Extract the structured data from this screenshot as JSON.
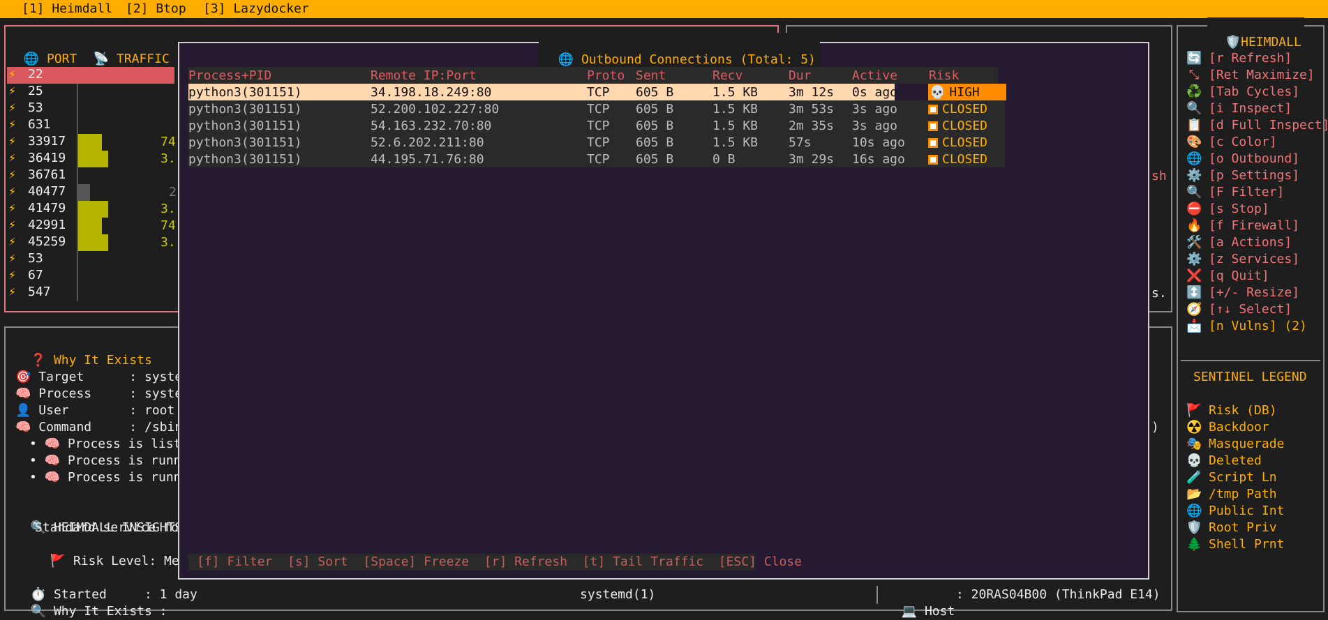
{
  "tabs": [
    "[1] Heimdall",
    "[2] Btop",
    "[3] Lazydocker"
  ],
  "left_panel": {
    "col_port": "PORT",
    "col_traffic": "TRAFFIC",
    "ports": [
      "22",
      "25",
      "53",
      "631",
      "33917",
      "36419",
      "36761",
      "40477",
      "41479",
      "42991",
      "45259",
      "53",
      "67",
      "547"
    ],
    "traffic_values": [
      "",
      "",
      "",
      "",
      "74",
      "3.",
      "",
      "2",
      "3.",
      "74",
      "3.",
      "",
      "",
      ""
    ],
    "traffic_fill": [
      0,
      0,
      0,
      0,
      0.7,
      0.9,
      0,
      0.35,
      0.9,
      0.7,
      0.9,
      0,
      0,
      0
    ]
  },
  "why": {
    "title": "Why It Exists",
    "rows": [
      {
        "icon": "target-icon",
        "glyph": "🎯",
        "text": "Target      : system"
      },
      {
        "icon": "brain-icon",
        "glyph": "🧠",
        "text": "Process     : system"
      },
      {
        "icon": "user-icon",
        "glyph": "👤",
        "text": "User        : root"
      },
      {
        "icon": "brain-icon",
        "glyph": "🧠",
        "text": "Command     : /sbin/"
      }
    ],
    "bullets": [
      "Process is liste",
      "Process is runni",
      "Process is runni"
    ],
    "insights_title": "HEIMDALL INSIGHTS (S",
    "insights_text": "Standard service for",
    "risk_level": "Risk Level: Mediu",
    "started": "Started     : 1 day",
    "why_label": "Why It Exists :",
    "process_name": "systemd(1)"
  },
  "host": {
    "label": "Host",
    "value": ": 20RAS04B00 (ThinkPad E14)"
  },
  "modal": {
    "title": "Outbound Connections (Total: 5)",
    "headers": [
      "Process+PID",
      "Remote IP:Port",
      "Proto",
      "Sent",
      "Recv",
      "Dur",
      "Active",
      "Risk"
    ],
    "rows": [
      {
        "process": "python3(301151)",
        "remote": "34.198.18.249:80",
        "proto": "TCP",
        "sent": "605 B",
        "recv": "1.5 KB",
        "dur": "3m 12s",
        "active": "0s ago",
        "risk": "HIGH"
      },
      {
        "process": "python3(301151)",
        "remote": "52.200.102.227:80",
        "proto": "TCP",
        "sent": "605 B",
        "recv": "1.5 KB",
        "dur": "3m 53s",
        "active": "3s ago",
        "risk": "CLOSED"
      },
      {
        "process": "python3(301151)",
        "remote": "54.163.232.70:80",
        "proto": "TCP",
        "sent": "605 B",
        "recv": "1.5 KB",
        "dur": "2m 35s",
        "active": "3s ago",
        "risk": "CLOSED"
      },
      {
        "process": "python3(301151)",
        "remote": "52.6.202.211:80",
        "proto": "TCP",
        "sent": "605 B",
        "recv": "1.5 KB",
        "dur": "57s",
        "active": "10s ago",
        "risk": "CLOSED"
      },
      {
        "process": "python3(301151)",
        "remote": "44.195.71.76:80",
        "proto": "TCP",
        "sent": "605 B",
        "recv": "0 B",
        "dur": "3m 29s",
        "active": "16s ago",
        "risk": "CLOSED"
      }
    ],
    "footer": "[f] Filter  [s] Sort  [Space] Freeze  [r] Refresh  [t] Tail Traffic  [ESC] Close"
  },
  "right_panel": {
    "title": "HEIMDALL",
    "items": [
      {
        "icon": "refresh-icon",
        "glyph": "🔄",
        "label": "[r Refresh]"
      },
      {
        "icon": "maximize-icon",
        "glyph": "⤡",
        "label": "[Ret Maximize]"
      },
      {
        "icon": "cycle-icon",
        "glyph": "♻️",
        "label": "[Tab Cycles]"
      },
      {
        "icon": "search-icon",
        "glyph": "🔍",
        "label": "[i Inspect]"
      },
      {
        "icon": "clipboard-icon",
        "glyph": "📋",
        "label": "[d Full Inspect]"
      },
      {
        "icon": "palette-icon",
        "glyph": "🎨",
        "label": "[c Color]"
      },
      {
        "icon": "globe-icon",
        "glyph": "🌐",
        "label": "[o Outbound]"
      },
      {
        "icon": "gear-icon",
        "glyph": "⚙️",
        "label": "[p Settings]"
      },
      {
        "icon": "search-icon",
        "glyph": "🔍",
        "label": "[F Filter]"
      },
      {
        "icon": "stop-icon",
        "glyph": "⛔",
        "label": "[s Stop]"
      },
      {
        "icon": "fire-icon",
        "glyph": "🔥",
        "label": "[f Firewall]"
      },
      {
        "icon": "tools-icon",
        "glyph": "🛠️",
        "label": "[a Actions]"
      },
      {
        "icon": "gear-icon",
        "glyph": "⚙️",
        "label": "[z Services]"
      },
      {
        "icon": "close-icon",
        "glyph": "❌",
        "label": "[q Quit]"
      },
      {
        "icon": "resize-icon",
        "glyph": "↕️",
        "label": "[+/- Resize]"
      },
      {
        "icon": "compass-icon",
        "glyph": "🧭",
        "label": "[↑↓ Select]"
      },
      {
        "icon": "inbox-icon",
        "glyph": "📩",
        "label": "[n Vulns] (2)"
      }
    ],
    "legend_title": "SENTINEL LEGEND",
    "legend": [
      {
        "icon": "flag-icon",
        "glyph": "🚩",
        "label": "Risk (DB)"
      },
      {
        "icon": "radioactive-icon",
        "glyph": "☢️",
        "label": "Backdoor"
      },
      {
        "icon": "masks-icon",
        "glyph": "🎭",
        "label": "Masquerade"
      },
      {
        "icon": "skull-icon",
        "glyph": "💀",
        "label": "Deleted"
      },
      {
        "icon": "testtube-icon",
        "glyph": "🧪",
        "label": "Script Ln"
      },
      {
        "icon": "folder-icon",
        "glyph": "📂",
        "label": "/tmp Path"
      },
      {
        "icon": "globe-icon",
        "glyph": "🌐",
        "label": "Public Int"
      },
      {
        "icon": "shield-icon",
        "glyph": "🛡️",
        "label": "Root Priv"
      },
      {
        "icon": "tree-icon",
        "glyph": "🌲",
        "label": "Shell Prnt"
      }
    ]
  },
  "background_fragments": [
    "sh",
    "s.",
    ")"
  ]
}
